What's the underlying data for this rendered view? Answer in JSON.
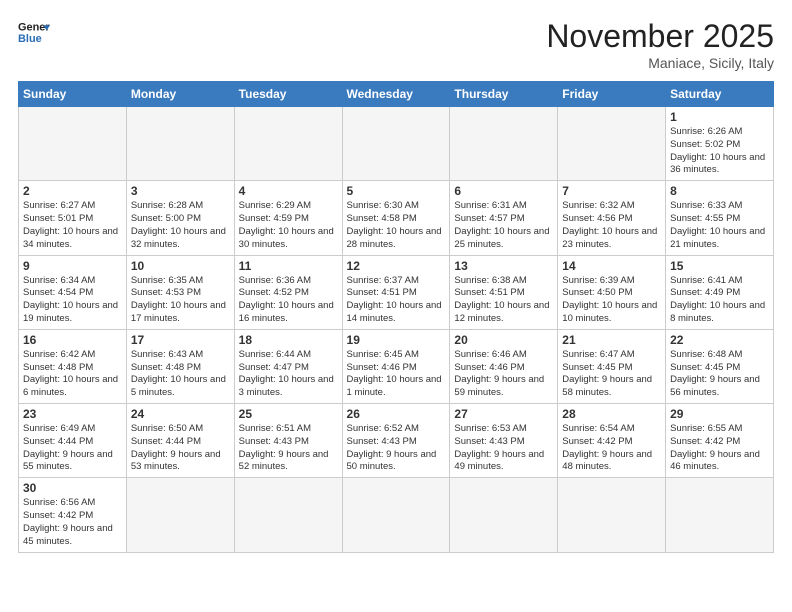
{
  "header": {
    "logo_general": "General",
    "logo_blue": "Blue",
    "month_title": "November 2025",
    "location": "Maniace, Sicily, Italy"
  },
  "weekdays": [
    "Sunday",
    "Monday",
    "Tuesday",
    "Wednesday",
    "Thursday",
    "Friday",
    "Saturday"
  ],
  "weeks": [
    [
      {
        "day": "",
        "info": ""
      },
      {
        "day": "",
        "info": ""
      },
      {
        "day": "",
        "info": ""
      },
      {
        "day": "",
        "info": ""
      },
      {
        "day": "",
        "info": ""
      },
      {
        "day": "",
        "info": ""
      },
      {
        "day": "1",
        "info": "Sunrise: 6:26 AM\nSunset: 5:02 PM\nDaylight: 10 hours and 36 minutes."
      }
    ],
    [
      {
        "day": "2",
        "info": "Sunrise: 6:27 AM\nSunset: 5:01 PM\nDaylight: 10 hours and 34 minutes."
      },
      {
        "day": "3",
        "info": "Sunrise: 6:28 AM\nSunset: 5:00 PM\nDaylight: 10 hours and 32 minutes."
      },
      {
        "day": "4",
        "info": "Sunrise: 6:29 AM\nSunset: 4:59 PM\nDaylight: 10 hours and 30 minutes."
      },
      {
        "day": "5",
        "info": "Sunrise: 6:30 AM\nSunset: 4:58 PM\nDaylight: 10 hours and 28 minutes."
      },
      {
        "day": "6",
        "info": "Sunrise: 6:31 AM\nSunset: 4:57 PM\nDaylight: 10 hours and 25 minutes."
      },
      {
        "day": "7",
        "info": "Sunrise: 6:32 AM\nSunset: 4:56 PM\nDaylight: 10 hours and 23 minutes."
      },
      {
        "day": "8",
        "info": "Sunrise: 6:33 AM\nSunset: 4:55 PM\nDaylight: 10 hours and 21 minutes."
      }
    ],
    [
      {
        "day": "9",
        "info": "Sunrise: 6:34 AM\nSunset: 4:54 PM\nDaylight: 10 hours and 19 minutes."
      },
      {
        "day": "10",
        "info": "Sunrise: 6:35 AM\nSunset: 4:53 PM\nDaylight: 10 hours and 17 minutes."
      },
      {
        "day": "11",
        "info": "Sunrise: 6:36 AM\nSunset: 4:52 PM\nDaylight: 10 hours and 16 minutes."
      },
      {
        "day": "12",
        "info": "Sunrise: 6:37 AM\nSunset: 4:51 PM\nDaylight: 10 hours and 14 minutes."
      },
      {
        "day": "13",
        "info": "Sunrise: 6:38 AM\nSunset: 4:51 PM\nDaylight: 10 hours and 12 minutes."
      },
      {
        "day": "14",
        "info": "Sunrise: 6:39 AM\nSunset: 4:50 PM\nDaylight: 10 hours and 10 minutes."
      },
      {
        "day": "15",
        "info": "Sunrise: 6:41 AM\nSunset: 4:49 PM\nDaylight: 10 hours and 8 minutes."
      }
    ],
    [
      {
        "day": "16",
        "info": "Sunrise: 6:42 AM\nSunset: 4:48 PM\nDaylight: 10 hours and 6 minutes."
      },
      {
        "day": "17",
        "info": "Sunrise: 6:43 AM\nSunset: 4:48 PM\nDaylight: 10 hours and 5 minutes."
      },
      {
        "day": "18",
        "info": "Sunrise: 6:44 AM\nSunset: 4:47 PM\nDaylight: 10 hours and 3 minutes."
      },
      {
        "day": "19",
        "info": "Sunrise: 6:45 AM\nSunset: 4:46 PM\nDaylight: 10 hours and 1 minute."
      },
      {
        "day": "20",
        "info": "Sunrise: 6:46 AM\nSunset: 4:46 PM\nDaylight: 9 hours and 59 minutes."
      },
      {
        "day": "21",
        "info": "Sunrise: 6:47 AM\nSunset: 4:45 PM\nDaylight: 9 hours and 58 minutes."
      },
      {
        "day": "22",
        "info": "Sunrise: 6:48 AM\nSunset: 4:45 PM\nDaylight: 9 hours and 56 minutes."
      }
    ],
    [
      {
        "day": "23",
        "info": "Sunrise: 6:49 AM\nSunset: 4:44 PM\nDaylight: 9 hours and 55 minutes."
      },
      {
        "day": "24",
        "info": "Sunrise: 6:50 AM\nSunset: 4:44 PM\nDaylight: 9 hours and 53 minutes."
      },
      {
        "day": "25",
        "info": "Sunrise: 6:51 AM\nSunset: 4:43 PM\nDaylight: 9 hours and 52 minutes."
      },
      {
        "day": "26",
        "info": "Sunrise: 6:52 AM\nSunset: 4:43 PM\nDaylight: 9 hours and 50 minutes."
      },
      {
        "day": "27",
        "info": "Sunrise: 6:53 AM\nSunset: 4:43 PM\nDaylight: 9 hours and 49 minutes."
      },
      {
        "day": "28",
        "info": "Sunrise: 6:54 AM\nSunset: 4:42 PM\nDaylight: 9 hours and 48 minutes."
      },
      {
        "day": "29",
        "info": "Sunrise: 6:55 AM\nSunset: 4:42 PM\nDaylight: 9 hours and 46 minutes."
      }
    ],
    [
      {
        "day": "30",
        "info": "Sunrise: 6:56 AM\nSunset: 4:42 PM\nDaylight: 9 hours and 45 minutes."
      },
      {
        "day": "",
        "info": ""
      },
      {
        "day": "",
        "info": ""
      },
      {
        "day": "",
        "info": ""
      },
      {
        "day": "",
        "info": ""
      },
      {
        "day": "",
        "info": ""
      },
      {
        "day": "",
        "info": ""
      }
    ]
  ]
}
